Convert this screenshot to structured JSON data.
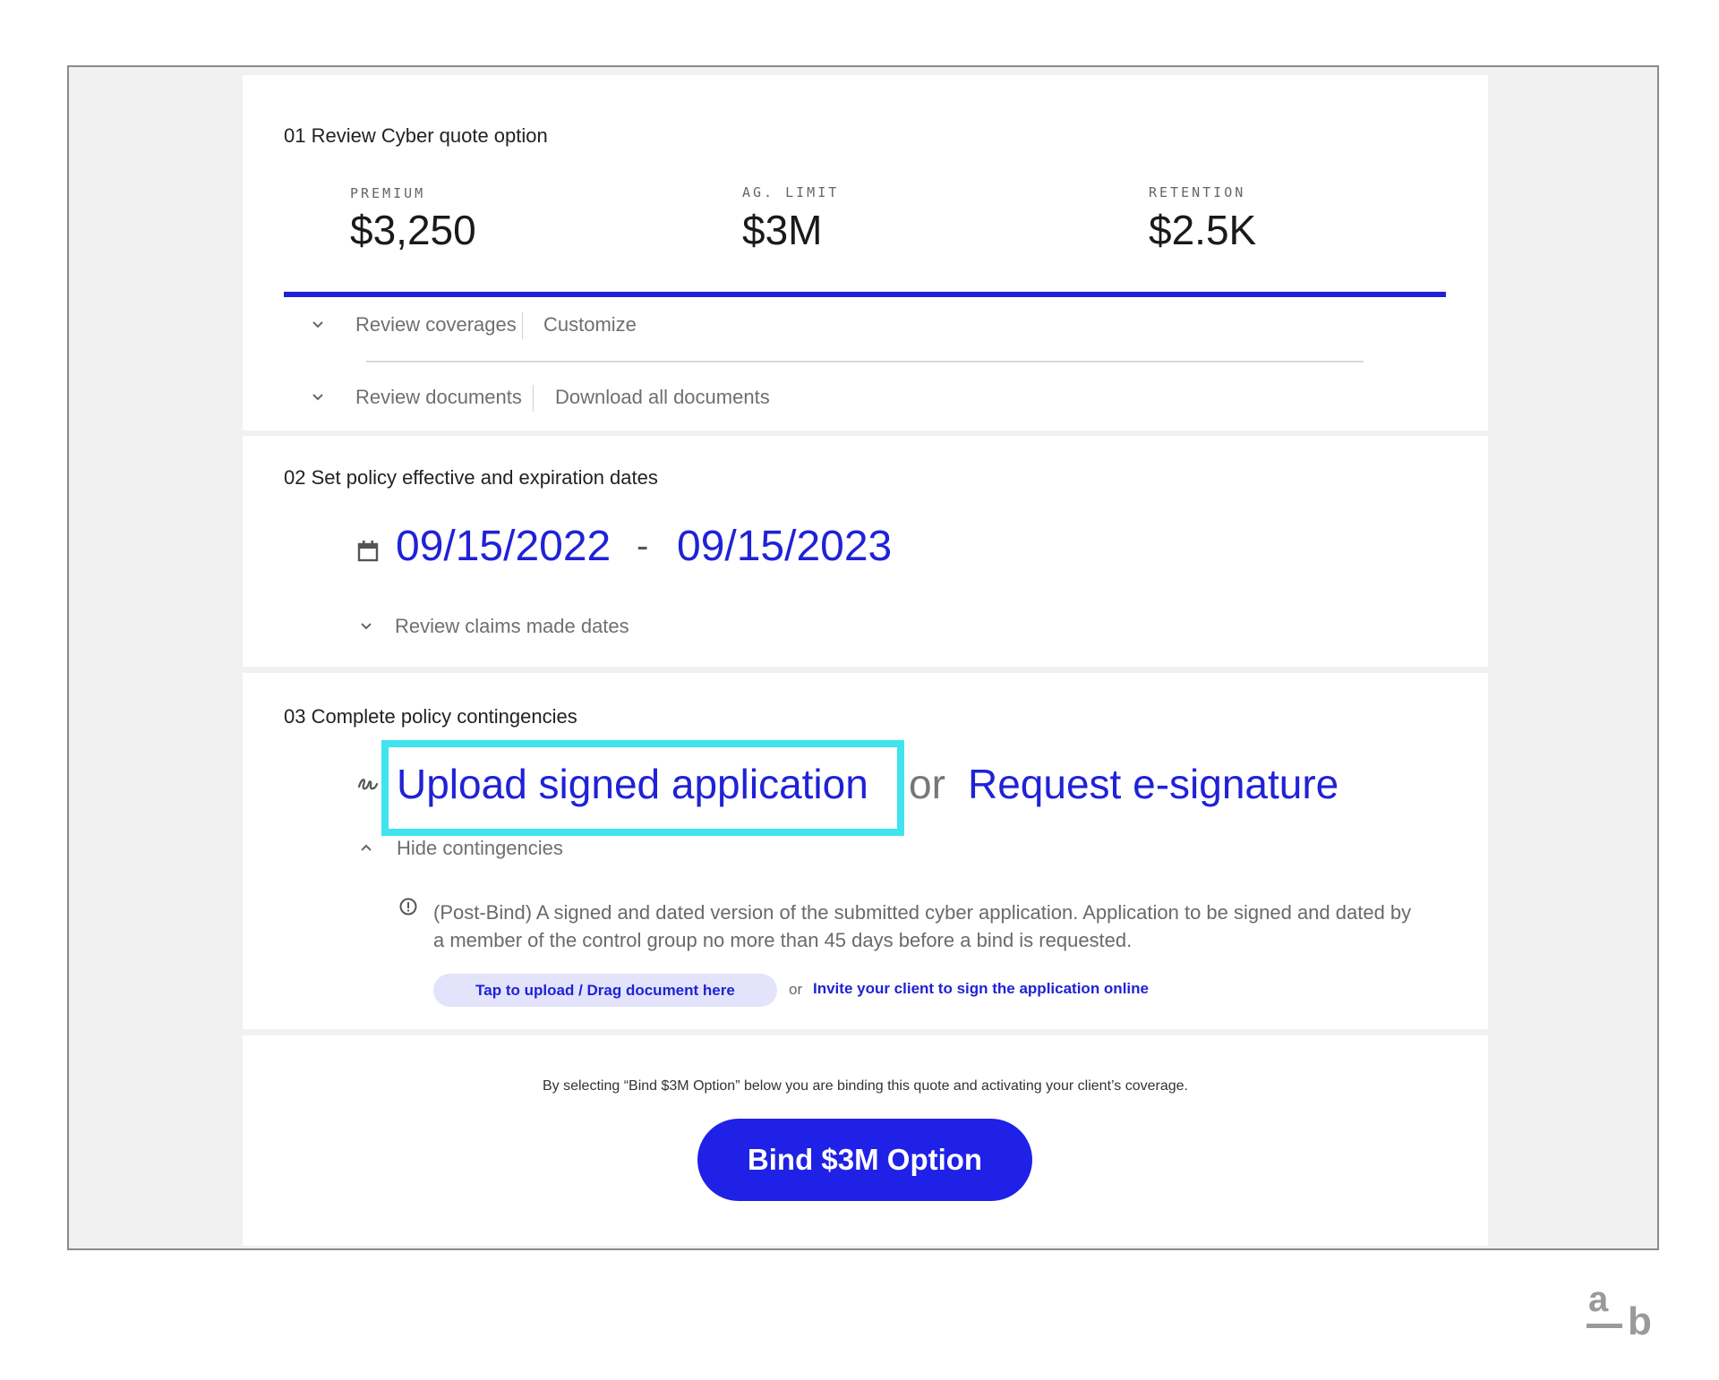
{
  "section1": {
    "title": "01 Review Cyber quote option",
    "stats": [
      {
        "label": "PREMIUM",
        "value": "$3,250"
      },
      {
        "label": "AG. LIMIT",
        "value": "$3M"
      },
      {
        "label": "RETENTION",
        "value": "$2.5K"
      }
    ],
    "rows": [
      {
        "primary": "Review coverages",
        "secondary": "Customize"
      },
      {
        "primary": "Review documents",
        "secondary": "Download all documents"
      }
    ]
  },
  "section2": {
    "title": "02 Set policy effective and expiration dates",
    "effective_date": "09/15/2022",
    "separator": "-",
    "expiration_date": "09/15/2023",
    "claims_toggle": "Review claims made dates"
  },
  "section3": {
    "title": "03 Complete policy contingencies",
    "upload_link": "Upload signed application",
    "or_text": "or",
    "esign_link": "Request e-signature",
    "hide_toggle": "Hide contingencies",
    "contingency_text": "(Post-Bind) A signed and dated version of the submitted cyber application. Application to be signed and dated by a member of the control group no more than 45 days before a bind is requested.",
    "upload_button": "Tap to upload / Drag document here",
    "small_or": "or",
    "invite_link": "Invite your client to sign the application online"
  },
  "bind": {
    "disclaimer": "By selecting “Bind $3M Option” below you are binding this quote and activating your client’s coverage.",
    "button_label": "Bind $3M Option"
  },
  "logo": {
    "top": "a",
    "bottom": "b"
  },
  "colors": {
    "accent": "#1f22d6",
    "highlight": "#3fe4ef",
    "background": "#f1f1f1"
  },
  "icons": [
    "chevron-down-icon",
    "calendar-icon",
    "signature-icon",
    "chevron-up-icon",
    "info-icon"
  ]
}
